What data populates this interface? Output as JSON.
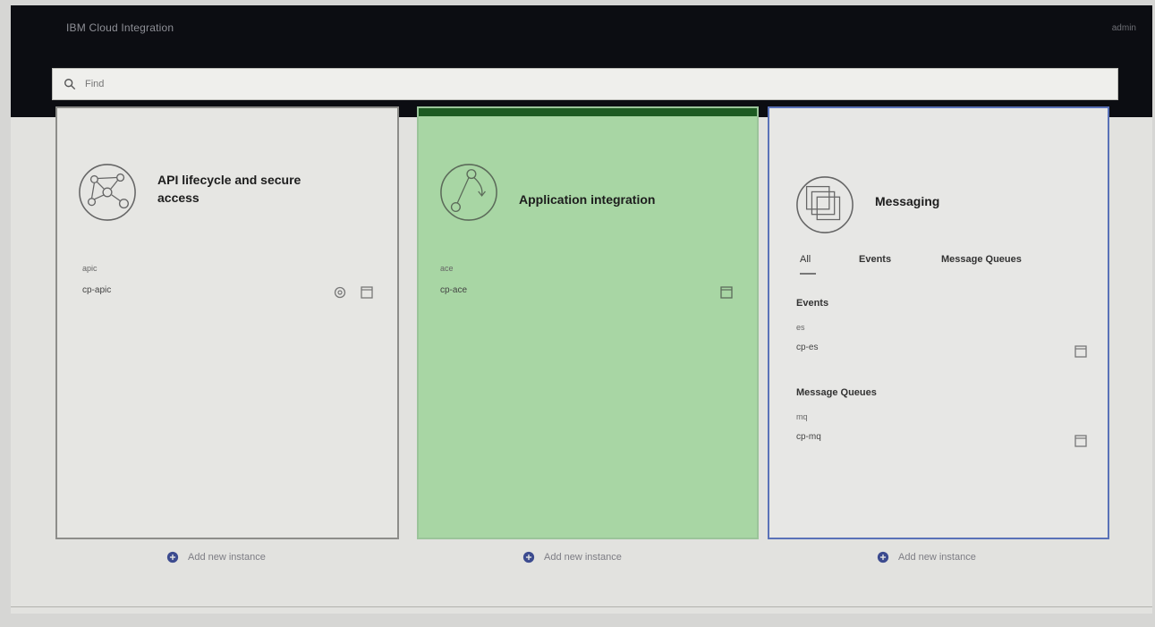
{
  "header": {
    "brand": "IBM Cloud Integration",
    "user": "admin"
  },
  "search": {
    "placeholder": "Find"
  },
  "cards": {
    "api": {
      "title": "API lifecycle and secure access",
      "instance_type": "apic",
      "instance_name": "cp-apic"
    },
    "app": {
      "title": "Application integration",
      "instance_type": "ace",
      "instance_name": "cp-ace"
    },
    "messaging": {
      "title": "Messaging",
      "tabs": [
        "All",
        "Events",
        "Message Queues"
      ],
      "sections": [
        {
          "heading": "Events",
          "instance_type": "es",
          "instance_name": "cp-es"
        },
        {
          "heading": "Message Queues",
          "instance_type": "mq",
          "instance_name": "cp-mq"
        }
      ]
    }
  },
  "actions": {
    "add_new_instance": "Add new instance"
  },
  "colors": {
    "topbar": "#0c0d12",
    "app_card_bg": "#a8d6a4",
    "app_card_accent": "#1d5b22",
    "messaging_border": "#5a72b8"
  }
}
